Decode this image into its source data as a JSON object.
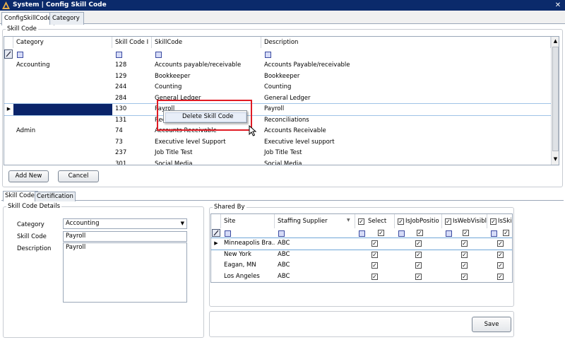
{
  "window": {
    "title": "System | Config Skill Code"
  },
  "tabs": [
    "ConfigSkillCode",
    "Category"
  ],
  "skill_code_group": {
    "title": "Skill Code"
  },
  "main_grid": {
    "columns": [
      "Category",
      "Skill Code I",
      "SkillCode",
      "Description"
    ],
    "rows": [
      {
        "category": "Accounting",
        "code": "128",
        "skill": "Accounts payable/receivable",
        "desc": "Accounts Payable/receivable"
      },
      {
        "category": "",
        "code": "129",
        "skill": "Bookkeeper",
        "desc": "Bookkeeper"
      },
      {
        "category": "",
        "code": "244",
        "skill": "Counting",
        "desc": "Counting"
      },
      {
        "category": "",
        "code": "284",
        "skill": "General Ledger",
        "desc": "General Ledger"
      },
      {
        "category": "",
        "code": "130",
        "skill": "Payroll",
        "desc": "Payroll"
      },
      {
        "category": "",
        "code": "131",
        "skill": "Rec",
        "desc": "Reconciliations"
      },
      {
        "category": "Admin",
        "code": "74",
        "skill": "Accounts Receivable",
        "desc": "Accounts Receivable"
      },
      {
        "category": "",
        "code": "73",
        "skill": "Executive level Support",
        "desc": "Executive level support"
      },
      {
        "category": "",
        "code": "237",
        "skill": "Job Title Test",
        "desc": "Job Title Test"
      },
      {
        "category": "",
        "code": "301",
        "skill": "Social Media",
        "desc": "Social Media"
      }
    ]
  },
  "context_menu": {
    "item": "Delete Skill Code"
  },
  "buttons": {
    "add_new": "Add New",
    "cancel": "Cancel",
    "save": "Save"
  },
  "sub_tabs": [
    "Skill Code",
    "Certification"
  ],
  "details": {
    "title": "Skill Code Details",
    "category_label": "Category",
    "category_value": "Accounting",
    "skill_code_label": "Skill Code",
    "skill_code_value": "Payroll",
    "description_label": "Description",
    "description_value": "Payroll"
  },
  "shared_by": {
    "title": "Shared By",
    "columns": [
      "Site",
      "Staffing Supplier",
      "Select",
      "IsJobPositio",
      "IsWebVisibl",
      "IsSki"
    ],
    "rows": [
      {
        "site": "Minneapolis Bra...",
        "supplier": "ABC"
      },
      {
        "site": "New York",
        "supplier": "ABC"
      },
      {
        "site": "Eagan, MN",
        "supplier": "ABC"
      },
      {
        "site": "Los Angeles",
        "supplier": "ABC"
      }
    ]
  },
  "colors": {
    "titlebar": "#0b2a6b",
    "selected_row": "#0a246a",
    "highlight_box": "#e01b24"
  }
}
